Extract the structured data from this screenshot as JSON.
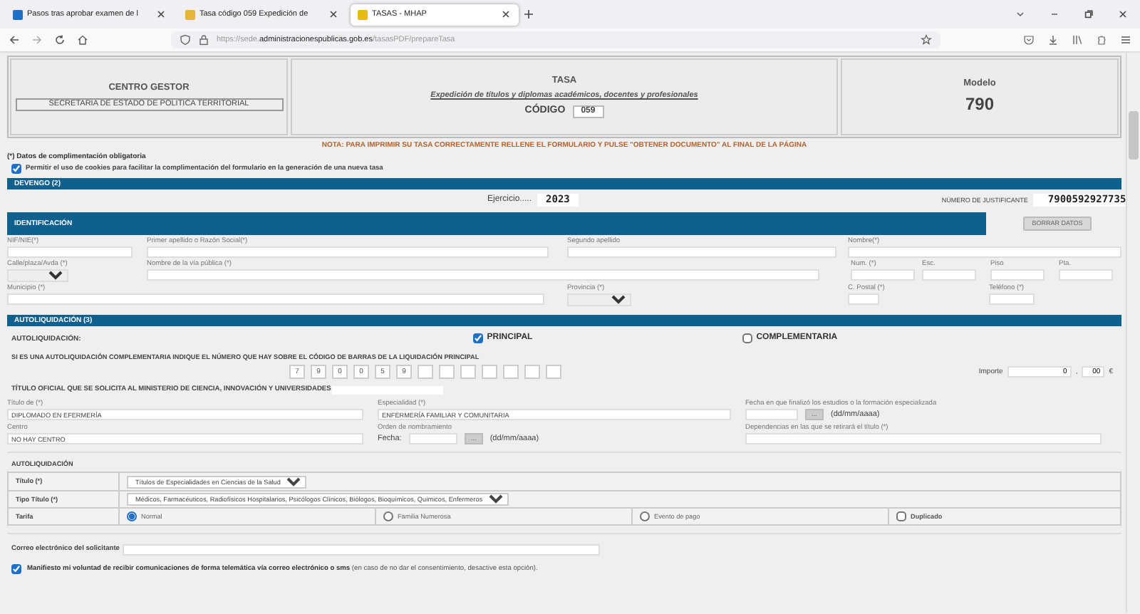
{
  "browser": {
    "tabs": [
      {
        "label": "Pasos tras aprobar examen de l",
        "selected": false
      },
      {
        "label": "Tasa código 059 Expedición de",
        "selected": false
      },
      {
        "label": "TASAS - MHAP",
        "selected": true
      }
    ],
    "url": {
      "prefix": "https://sede.",
      "domain": "administracionespublicas.gob.es",
      "path": "/tasasPDF/prepareTasa"
    }
  },
  "header": {
    "centro_gestor": {
      "title": "CENTRO GESTOR",
      "value": "SECRETARIA DE ESTADO DE POLITICA TERRITORIAL"
    },
    "tasa": {
      "title": "TASA",
      "subtitle": "Expedición de títulos y diplomas académicos, docentes y profesionales",
      "codigo_label": "CÓDIGO",
      "codigo": "059"
    },
    "modelo": {
      "title": "Modelo",
      "number": "790"
    }
  },
  "note": "NOTA: PARA IMPRIMIR SU TASA CORRECTAMENTE RELLENE EL FORMULARIO Y PULSE \"OBTENER DOCUMENTO\" AL FINAL DE LA PÁGINA",
  "required_note": "(*) Datos de complimentación obligatoria",
  "cookies": {
    "label": "Permitir el uso de cookies para facilitar la complimentación del formulario en la generación de una nueva tasa",
    "checked": true
  },
  "devengo": {
    "title": "DEVENGO (2)",
    "ejercicio_label": "Ejercicio.....",
    "ejercicio": "2023",
    "justificante_label": "NÚMERO DE JUSTIFICANTE",
    "justificante": "7900592927735"
  },
  "identificacion": {
    "title": "IDENTIFICACIÓN",
    "clear_button": "BORRAR DATOS",
    "rows": [
      {
        "fields": [
          {
            "label": "NIF/NIE(*)",
            "kind": "text"
          },
          {
            "label": "Primer apellido o Razón Social(*)",
            "kind": "text"
          },
          {
            "label": "Segundo apellido",
            "kind": "text"
          },
          {
            "label": "Nombre(*)",
            "kind": "text"
          }
        ]
      },
      {
        "fields": [
          {
            "label": "Calle/plaza/Avda (*)",
            "kind": "select"
          },
          {
            "label": "Nombre de la vía pública (*)",
            "kind": "text"
          },
          {
            "label": "Num. (*)",
            "kind": "text"
          },
          {
            "label": "Esc.",
            "kind": "text"
          },
          {
            "label": "Piso",
            "kind": "text"
          },
          {
            "label": "Pta.",
            "kind": "text"
          }
        ]
      },
      {
        "fields": [
          {
            "label": "Municipio (*)",
            "kind": "text"
          },
          {
            "label": "Provincia (*)",
            "kind": "select"
          },
          {
            "label": "C. Postal (*)",
            "kind": "text"
          },
          {
            "label": "Teléfono (*)",
            "kind": "text"
          }
        ]
      }
    ]
  },
  "autoliquidacion": {
    "title": "AUTOLIQUIDACIÓN (3)",
    "type_label": "AUTOLIQUIDACIÓN:",
    "options": [
      {
        "label": "PRINCIPAL",
        "checked": true
      },
      {
        "label": "COMPLEMENTARIA",
        "checked": false
      }
    ],
    "complementaria_note": "SI ES UNA AUTOLIQUIDACIÓN COMPLEMENTARIA INDIQUE EL NÚMERO QUE HAY SOBRE EL CÓDIGO DE BARRAS DE LA LIQUIDACIÓN PRINCIPAL",
    "code_digits": [
      "7",
      "9",
      "0",
      "0",
      "5",
      "9"
    ],
    "importe": {
      "label": "Importe",
      "euros": "0",
      "separator": ",",
      "cents": "00",
      "currency": "€"
    }
  },
  "titulo_oficial": {
    "title": "TÍTULO OFICIAL QUE SE SOLICITA AL MINISTERIO DE CIENCIA, INNOVACIÓN Y UNIVERSIDADES",
    "titulo_label": "Título de (*)",
    "titulo_value": "DIPLOMADO EN EFERMERÍA",
    "especialidad_label": "Especialidad (*)",
    "especialidad_value": "ENFERMERÍA FAMILIAR Y COMUNITARIA",
    "fecha_fin_label": "Fecha en que finalizó los estudios o la formación especializada",
    "date_button": "...",
    "date_format": "(dd/mm/aaaa)",
    "centro_label": "Centro",
    "centro_value": "NO HAY CENTRO",
    "orden_label": "Orden de nombramiento",
    "orden_fecha_label": "Fecha:",
    "orden_date_button": "...",
    "orden_date_format": "(dd/mm/aaaa)",
    "dependencias_label": "Dependencias en las que se retirará el título (*)"
  },
  "autoliquidacion_table": {
    "title": "AUTOLIQUIDACIÓN",
    "rows": [
      {
        "label": "Título (*)",
        "kind": "select",
        "value": "Títulos de Especialidades en Ciencias de la Salud"
      },
      {
        "label": "Tipo Título (*)",
        "kind": "select",
        "value": "Médicos, Farmacéuticos, Radiofísicos Hospitalarios, Psicólogos Clínicos, Biólogos, Bioquímicos, Químicos, Enfermeros"
      },
      {
        "label": "Tarifa",
        "kind": "options",
        "options": [
          {
            "label": "Normal",
            "selected": true
          },
          {
            "label": "Familia Numerosa",
            "selected": false
          },
          {
            "label": "Evento de pago",
            "selected": false
          }
        ],
        "duplicado": {
          "label": "Duplicado",
          "checked": false
        }
      }
    ]
  },
  "email": {
    "label": "Correo electrónico del solicitante"
  },
  "consent": {
    "text": "**Manifiesto mi voluntad de recibir comunicaciones de forma telemática vía correo electrónico o sms** (en caso de no dar el consentimiento, desactive esta opción).",
    "checked": true
  }
}
